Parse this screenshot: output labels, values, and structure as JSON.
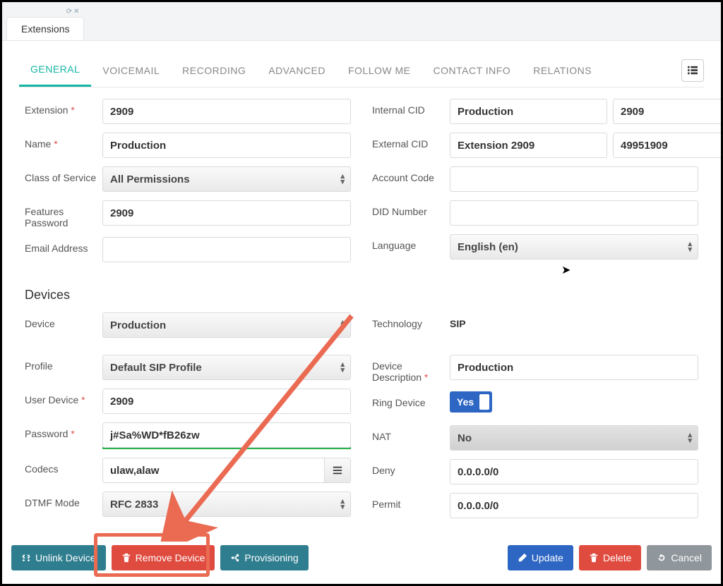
{
  "window_tab": "Extensions",
  "tabs": {
    "general": "GENERAL",
    "voicemail": "VOICEMAIL",
    "recording": "RECORDING",
    "advanced": "ADVANCED",
    "followme": "FOLLOW ME",
    "contactinfo": "CONTACT INFO",
    "relations": "RELATIONS"
  },
  "labels": {
    "extension": "Extension",
    "name": "Name",
    "cos": "Class of Service",
    "features_pw": "Features Password",
    "email": "Email Address",
    "internal_cid": "Internal CID",
    "external_cid": "External CID",
    "account_code": "Account Code",
    "did_number": "DID Number",
    "language": "Language",
    "device": "Device",
    "profile": "Profile",
    "user_device": "User Device",
    "password": "Password",
    "codecs": "Codecs",
    "dtmf": "DTMF Mode",
    "technology": "Technology",
    "device_desc": "Device Description",
    "ring_device": "Ring Device",
    "nat": "NAT",
    "deny": "Deny",
    "permit": "Permit"
  },
  "values": {
    "extension": "2909",
    "name": "Production",
    "cos": "All Permissions",
    "features_pw": "2909",
    "email": "",
    "internal_cid_name": "Production",
    "internal_cid_num": "2909",
    "external_cid_name": "Extension 2909",
    "external_cid_num": "49951909",
    "account_code": "",
    "did_number": "",
    "language": "English (en)",
    "device": "Production",
    "profile": "Default SIP Profile",
    "user_device": "2909",
    "password": "j#Sa%WD*fB26zw",
    "codecs": "ulaw,alaw",
    "dtmf": "RFC 2833",
    "technology": "SIP",
    "device_desc": "Production",
    "ring_device": "Yes",
    "nat": "No",
    "deny": "0.0.0.0/0",
    "permit": "0.0.0.0/0"
  },
  "section": {
    "devices": "Devices"
  },
  "footer": {
    "unlink": "Unlink Device",
    "remove": "Remove Device",
    "provisioning": "Provisioning",
    "update": "Update",
    "delete": "Delete",
    "cancel": "Cancel"
  }
}
